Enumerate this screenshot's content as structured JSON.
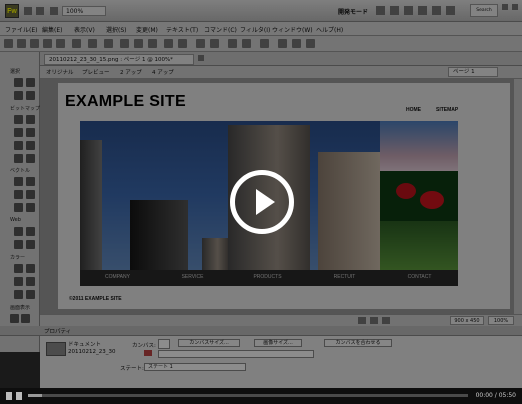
{
  "app": {
    "logo_text": "Fw",
    "zoom_display": "100%",
    "mode_label": "開発モード",
    "search_hint": "Search"
  },
  "menu": {
    "items": [
      "ファイル(E)",
      "編集(E)",
      "表示(V)",
      "選択(S)",
      "変更(M)",
      "テキスト(T)",
      "コマンド(C)",
      "フィルタ(I)",
      "ウィンドウ(W)",
      "ヘルプ(H)"
    ]
  },
  "tools_panel": {
    "sections": [
      "選択",
      "ビットマップ",
      "ベクトル",
      "Web",
      "カラー",
      "画面表示"
    ]
  },
  "document": {
    "tab_title": "20110212_23_30_15.png : ページ 1 @ 100%*",
    "views": [
      "オリジナル",
      "プレビュー",
      "2 アップ",
      "4 アップ"
    ],
    "page_selector": "ページ 1"
  },
  "mock_site": {
    "title": "EXAMPLE SITE",
    "top_links": [
      "HOME",
      "SITEMAP"
    ],
    "nav": [
      "COMPANY",
      "SERVICE",
      "PRODUCTS",
      "RECTUIT",
      "CONTACT"
    ],
    "copyright": "©2011  EXAMPLE SITE"
  },
  "status": {
    "size": "900 x 450",
    "zoom": "100%"
  },
  "properties": {
    "panel_title": "プロパティ",
    "doc_label": "ドキュメント",
    "doc_name": "20110212_23_30",
    "canvas_label": "カンバス:",
    "buttons": [
      "カンバスサイズ...",
      "画像サイズ...",
      "カンバスを合わせる"
    ],
    "state_label": "ステート:",
    "state_value": "ステート 1"
  },
  "player": {
    "time": "00:00 / 05:50"
  }
}
